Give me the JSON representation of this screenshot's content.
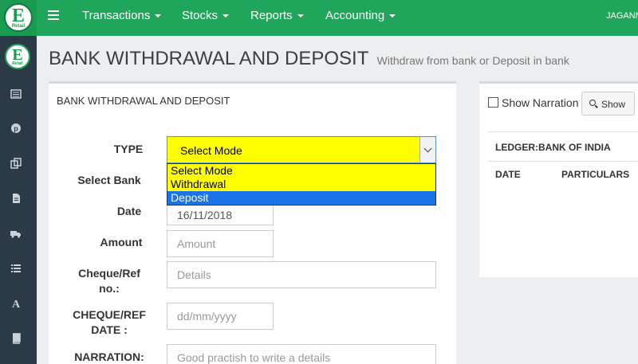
{
  "brand": {
    "logo_letter": "E",
    "logo_sub": "Retail"
  },
  "nav": {
    "items": [
      {
        "label": "Transactions"
      },
      {
        "label": "Stocks"
      },
      {
        "label": "Reports"
      },
      {
        "label": "Accounting"
      }
    ],
    "user": "JAGANN"
  },
  "sidebar": {
    "icons": [
      "list-icon",
      "pinterest-icon",
      "copy-icon",
      "file-icon",
      "truck-icon",
      "list-ul-icon",
      "font-icon",
      "book-icon"
    ]
  },
  "page": {
    "title": "BANK WITHDRAWAL AND DEPOSIT",
    "subtitle": "Withdraw from bank or Deposit in bank"
  },
  "form": {
    "panel_title": "BANK WITHDRAWAL AND DEPOSIT",
    "type_label": "TYPE",
    "type_value": "Select Mode",
    "type_options": [
      "Select Mode",
      "Withdrawal",
      "Deposit"
    ],
    "type_highlighted": "Deposit",
    "bank_label": "Select Bank",
    "date_label": "Date",
    "date_value": "16/11/2018",
    "amount_label": "Amount",
    "amount_placeholder": "Amount",
    "cheque_label_1": "Cheque/Ref",
    "cheque_label_2": "no.:",
    "cheque_placeholder": "Details",
    "cheque_date_label_1": "CHEQUE/REF",
    "cheque_date_label_2": "DATE :",
    "cheque_date_placeholder": "dd/mm/yyyy",
    "narration_label": "NARRATION:",
    "narration_placeholder": "Good practish to write a details"
  },
  "ledger_panel": {
    "show_narration": "Show Narration",
    "show_button": "Show",
    "ledger_label": "LEDGER:BANK OF INDIA",
    "columns": [
      "DATE",
      "PARTICULARS"
    ]
  },
  "colors": {
    "navbar": "#1fa65a",
    "sidebar": "#2c3a47",
    "select_bg": "#ffff00",
    "option_highlight": "#1a73e8"
  }
}
